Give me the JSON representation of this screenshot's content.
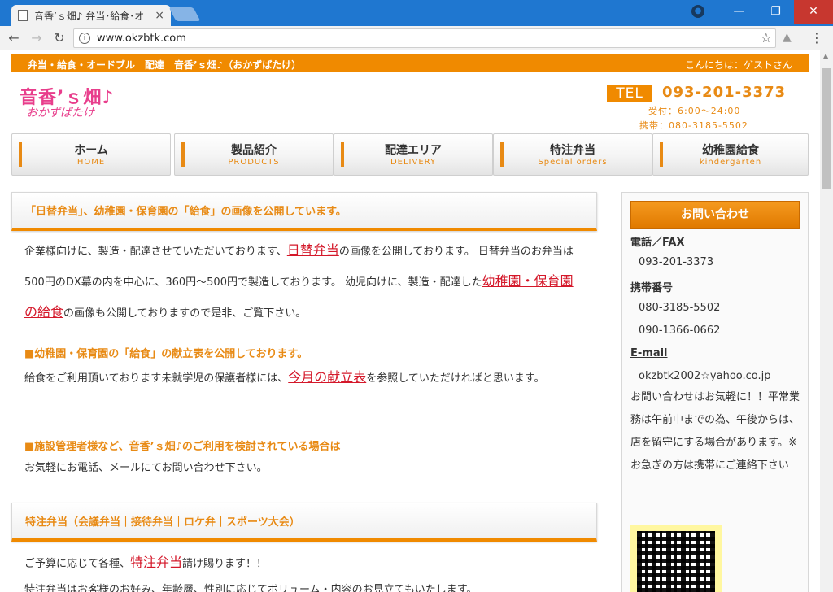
{
  "browser": {
    "tab_title": "音香’ｓ畑♪ 弁当･給食･オ",
    "tab_close": "×",
    "url": "www.okzbtk.com",
    "window_min": "—",
    "window_max": "❐",
    "window_close": "✕",
    "nav_back": "←",
    "nav_forward": "→",
    "nav_reload": "↻",
    "star": "☆",
    "menu": "⋮",
    "info": "i",
    "profile": "●",
    "drive": "▲"
  },
  "topbar": {
    "left": "弁当・給食・オードブル　配達　音香’ｓ畑♪（おかずばたけ）",
    "right": "こんにちは：ゲストさん"
  },
  "logo": {
    "line1": "音香’ｓ畑♪",
    "line2": "おかずばたけ"
  },
  "contact_header": {
    "tel_badge": "TEL",
    "tel_number": "093-201-3373",
    "hours": "受付：6:00～24:00",
    "mobile": "携帯：080-3185-5502"
  },
  "nav": [
    {
      "label": "ホーム",
      "sub": "HOME"
    },
    {
      "label": "製品紹介",
      "sub": "PRODUCTS"
    },
    {
      "label": "配達エリア",
      "sub": "DELIVERY"
    },
    {
      "label": "特注弁当",
      "sub": "Special orders"
    },
    {
      "label": "幼稚園給食",
      "sub": "kindergarten"
    }
  ],
  "main": {
    "section1_title": "「日替弁当」、幼稚園・保育園の「給食」の画像を公開しています。",
    "p1_a": "企業様向けに、製造・配達させていただいております、",
    "p1_link1": "日替弁当",
    "p1_b": "の画像を公開しております。 日替弁当のお弁当は500円のDX幕の内を中心に、360円～500円で製造しております。 幼児向けに、製造・配達した",
    "p1_link2": "幼稚園・保育園の給食",
    "p1_c": "の画像も公開しておりますので是非、ご覧下さい。",
    "sub1": "■幼稚園・保育園の「給食」の献立表を公開しております。",
    "p2_a": "給食をご利用頂いております未就学児の保護者様には、",
    "p2_link": "今月の献立表",
    "p2_b": "を参照していただければと思います。",
    "sub2": "■施設管理者様など、音香’ｓ畑♪のご利用を検討されている場合は",
    "p3": "お気軽にお電話、メールにてお問い合わせ下さい。",
    "section2_title": "特注弁当（会議弁当｜接待弁当｜ロケ弁｜スポーツ大会）",
    "p4_a": "ご予算に応じて各種、",
    "p4_link": "特注弁当",
    "p4_b": "請け賜ります！！",
    "p4_c": "特注弁当はお客様のお好み、年齢層、性別に応じてボリューム・内容のお見立てもいたします。"
  },
  "sidebar": {
    "button": "お問い合わせ",
    "tel_fax_label": "電話／FAX",
    "tel_fax": "093-201-3373",
    "mobile_label": "携帯番号",
    "mobile1": "080-3185-5502",
    "mobile2": "090-1366-0662",
    "email_label": "E-mail",
    "email": "okzbtk2002☆yahoo.co.jp",
    "note": "お問い合わせはお気軽に！！平常業務は午前中までの為、午後からは、店を留守にする場合があります。※お急ぎの方は携帯にご連絡下さい"
  }
}
